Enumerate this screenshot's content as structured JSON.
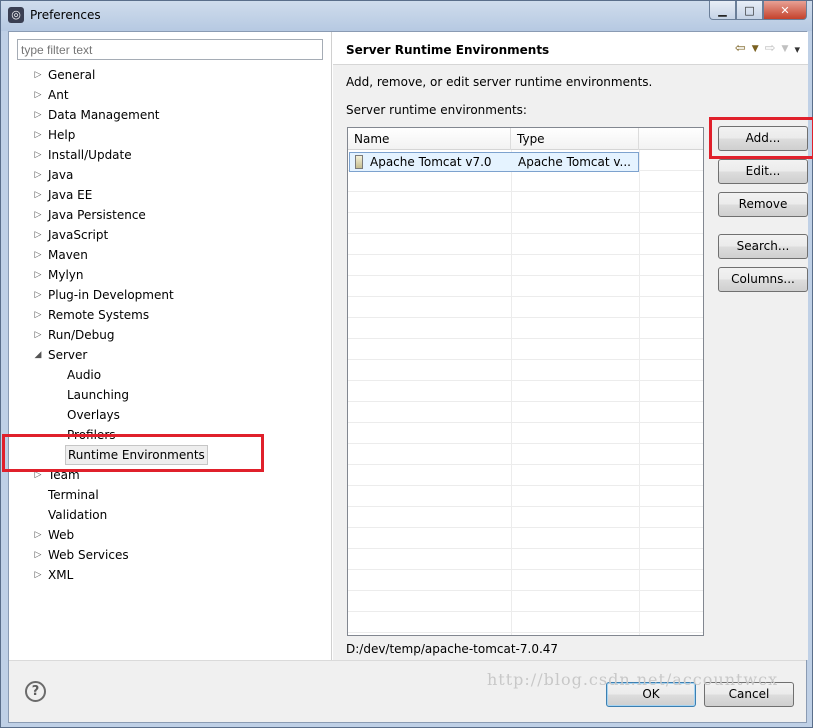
{
  "window": {
    "title": "Preferences"
  },
  "filter": {
    "placeholder": "type filter text"
  },
  "tree": [
    {
      "label": "General",
      "expanded": false,
      "level": 0
    },
    {
      "label": "Ant",
      "expanded": false,
      "level": 0
    },
    {
      "label": "Data Management",
      "expanded": false,
      "level": 0
    },
    {
      "label": "Help",
      "expanded": false,
      "level": 0
    },
    {
      "label": "Install/Update",
      "expanded": false,
      "level": 0
    },
    {
      "label": "Java",
      "expanded": false,
      "level": 0
    },
    {
      "label": "Java EE",
      "expanded": false,
      "level": 0
    },
    {
      "label": "Java Persistence",
      "expanded": false,
      "level": 0
    },
    {
      "label": "JavaScript",
      "expanded": false,
      "level": 0
    },
    {
      "label": "Maven",
      "expanded": false,
      "level": 0
    },
    {
      "label": "Mylyn",
      "expanded": false,
      "level": 0
    },
    {
      "label": "Plug-in Development",
      "expanded": false,
      "level": 0
    },
    {
      "label": "Remote Systems",
      "expanded": false,
      "level": 0
    },
    {
      "label": "Run/Debug",
      "expanded": false,
      "level": 0
    },
    {
      "label": "Server",
      "expanded": true,
      "level": 0
    },
    {
      "label": "Audio",
      "level": 1
    },
    {
      "label": "Launching",
      "level": 1
    },
    {
      "label": "Overlays",
      "level": 1
    },
    {
      "label": "Profilers",
      "level": 1
    },
    {
      "label": "Runtime Environments",
      "level": 1,
      "selected": true
    },
    {
      "label": "Team",
      "expanded": false,
      "level": 0
    },
    {
      "label": "Terminal",
      "level": 0,
      "leaf": true
    },
    {
      "label": "Validation",
      "level": 0,
      "leaf": true
    },
    {
      "label": "Web",
      "expanded": false,
      "level": 0
    },
    {
      "label": "Web Services",
      "expanded": false,
      "level": 0
    },
    {
      "label": "XML",
      "expanded": false,
      "level": 0
    }
  ],
  "page": {
    "title": "Server Runtime Environments",
    "description": "Add, remove, or edit server runtime environments.",
    "list_label": "Server runtime environments:",
    "columns": [
      "Name",
      "Type"
    ],
    "rows": [
      {
        "name": "Apache Tomcat v7.0",
        "type": "Apache Tomcat v..."
      }
    ],
    "location": "D:/dev/temp/apache-tomcat-7.0.47"
  },
  "buttons": {
    "add": "Add...",
    "edit": "Edit...",
    "remove": "Remove",
    "search": "Search...",
    "columns": "Columns..."
  },
  "footer": {
    "ok": "OK",
    "cancel": "Cancel",
    "help_glyph": "?"
  },
  "watermark": "http://blog.csdn.net/accountwcx",
  "colors": {
    "annotation_red": "#e0202b",
    "selection_blue": "#e5f3ff"
  }
}
